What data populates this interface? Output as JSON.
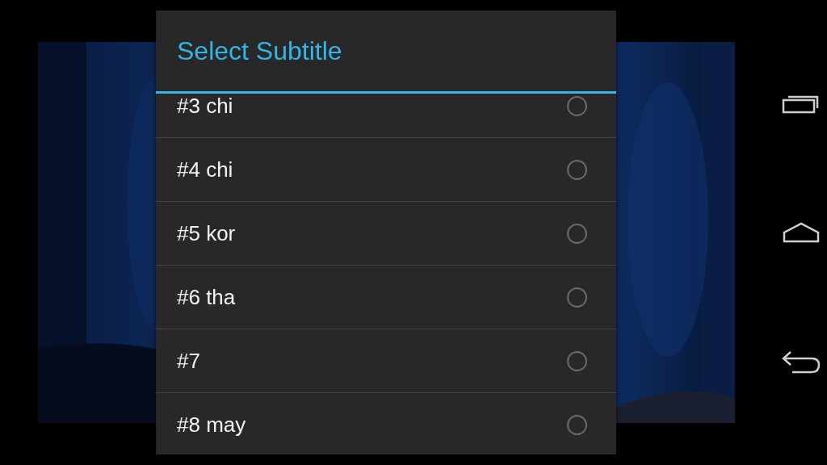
{
  "dialog": {
    "title": "Select Subtitle",
    "options": [
      {
        "label": "#3 chi",
        "selected": false
      },
      {
        "label": "#4 chi",
        "selected": false
      },
      {
        "label": "#5 kor",
        "selected": false
      },
      {
        "label": "#6 tha",
        "selected": false
      },
      {
        "label": "#7",
        "selected": false
      },
      {
        "label": "#8 may",
        "selected": false
      }
    ]
  }
}
